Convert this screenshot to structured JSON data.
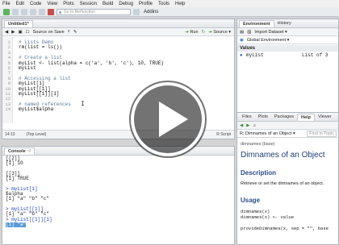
{
  "menu": [
    "File",
    "Edit",
    "Code",
    "View",
    "Plots",
    "Session",
    "Build",
    "Debug",
    "Profile",
    "Tools",
    "Help"
  ],
  "toolbar": {
    "goto_placeholder": "Go to file/function",
    "addins": "Addins"
  },
  "editor": {
    "tab": "Untitled1*",
    "source_on_save": "Source on Save",
    "run": "Run",
    "source": "Source",
    "lines": [
      "1",
      "2",
      "3",
      "4",
      "5",
      "6",
      "7",
      "8",
      "9",
      "10",
      "11",
      "12",
      "13",
      "14"
    ],
    "code": [
      "# Lists Demo",
      "rm(list = ls())",
      "",
      "# Create a list",
      "myList <- list(alpha = c('a', 'b', 'c'), 10, TRUE)",
      "myList",
      "",
      "# Accessing a list",
      "myList[1]",
      "myList[[1]]",
      "myList[[1]][1]",
      "",
      "# named references",
      "myList$alpha"
    ],
    "position": "14:13",
    "level": "(Top Level)",
    "filetype": "R Script"
  },
  "console": {
    "title": "Console",
    "path": "~/",
    "lines": [
      "[[2]]",
      "[1] 10",
      "",
      "[[3]]",
      "[1] TRUE",
      "",
      "> myList[1]",
      "$alpha",
      "[1] \"a\" \"b\" \"c\"",
      "",
      "> myList[[1]]",
      "[1] \"a\" \"b\" \"c\"",
      "> myList[[1]][1]",
      "[1] \"a\""
    ]
  },
  "environment": {
    "tabs": [
      "Environment",
      "History"
    ],
    "import": "Import Dataset",
    "scope": "Global Environment",
    "section": "Values",
    "var_name": "myList",
    "var_value": "List of 3"
  },
  "help": {
    "tabs": [
      "Files",
      "Plots",
      "Packages",
      "Help",
      "Viewer"
    ],
    "topic": "R: Dimnames of an Object",
    "find_placeholder": "Find in Topic",
    "pkg": "dimnames {base}",
    "title": "Dimnames of an Object",
    "desc_head": "Description",
    "desc": "Retrieve or set the dimnames of an object.",
    "usage_head": "Usage",
    "usage": [
      "dimnames(x)",
      "dimnames(x) <- value",
      "",
      "provideDimnames(x, sep = \"\", base"
    ]
  }
}
